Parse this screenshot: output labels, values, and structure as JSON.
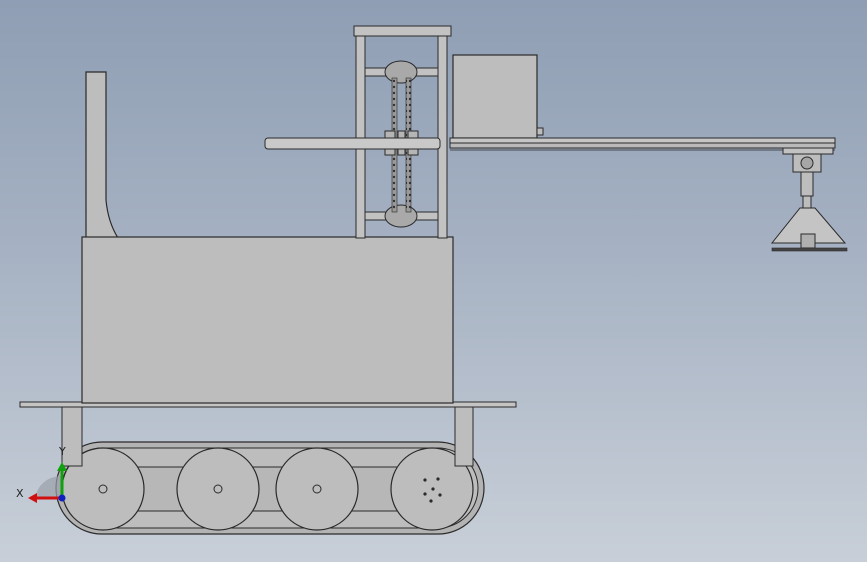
{
  "view": {
    "background_top": "#8f9eb4",
    "background_bottom": "#c8cfd8",
    "part_fill": "#bdbdbd",
    "part_stroke": "#2a2a2a"
  },
  "triad": {
    "x_label": "X",
    "y_label": "Y",
    "x_color": "#d01010",
    "y_color": "#10a010",
    "z_color": "#1020c0"
  }
}
